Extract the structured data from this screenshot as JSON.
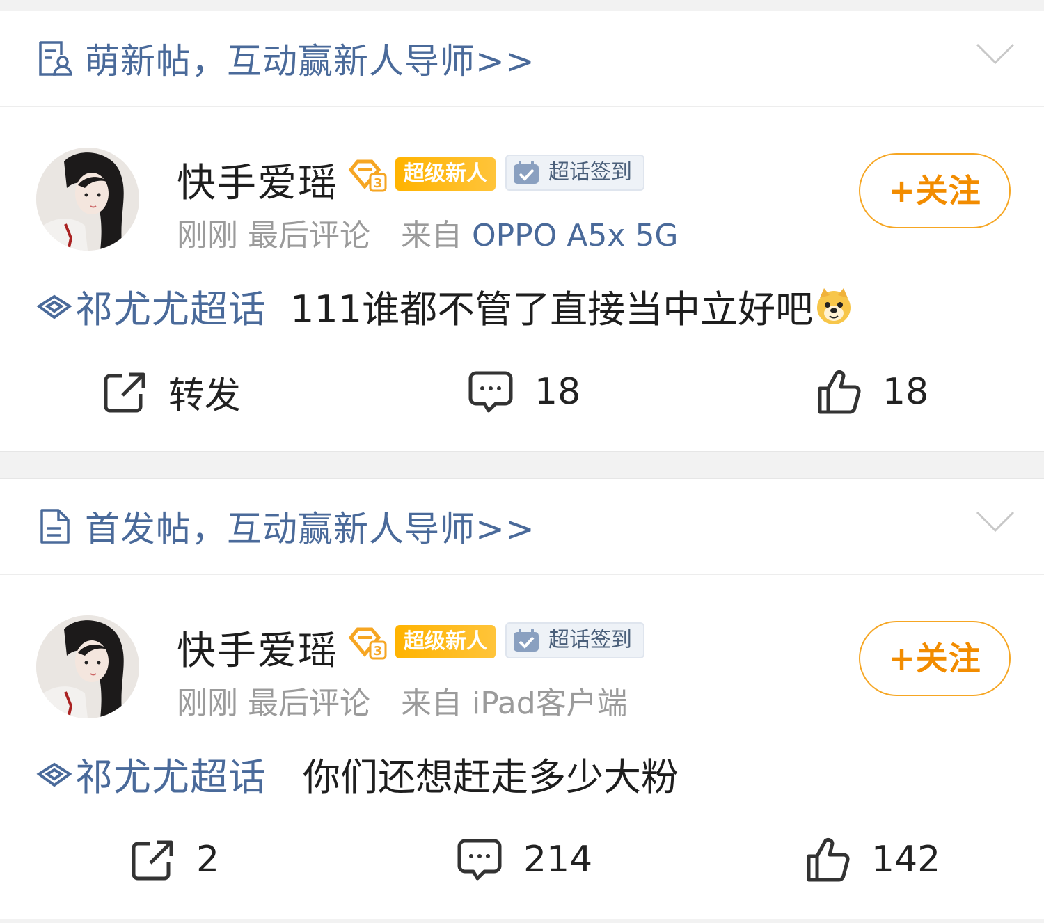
{
  "posts": [
    {
      "banner": {
        "text": "萌新帖，互动赢新人导师>>",
        "icon": "newbie-post-icon"
      },
      "user": {
        "name": "快手爱瑶",
        "level_badge": "3",
        "badge_new": "超级新人",
        "badge_sign": "超话签到",
        "time": "刚刚",
        "last_action": "最后评论",
        "source_prefix": "来自",
        "device": "OPPO A5x 5G"
      },
      "follow_label": "+关注",
      "topic": "祁尤尤超话",
      "text": "111谁都不管了直接当中立好吧",
      "actions": {
        "repost": "转发",
        "comments": "18",
        "likes": "18"
      }
    },
    {
      "banner": {
        "text": "首发帖，互动赢新人导师>>",
        "icon": "document-icon"
      },
      "user": {
        "name": "快手爱瑶",
        "level_badge": "3",
        "badge_new": "超级新人",
        "badge_sign": "超话签到",
        "time": "刚刚",
        "last_action": "最后评论",
        "source_prefix": "来自",
        "device": "iPad客户端"
      },
      "follow_label": "+关注",
      "topic": "祁尤尤超话",
      "text": "你们还想赶走多少大粉",
      "actions": {
        "repost": "2",
        "comments": "214",
        "likes": "142"
      }
    }
  ],
  "colors": {
    "link": "#4a6a9a",
    "accent": "#f28c00",
    "badge": "#ffb300"
  }
}
